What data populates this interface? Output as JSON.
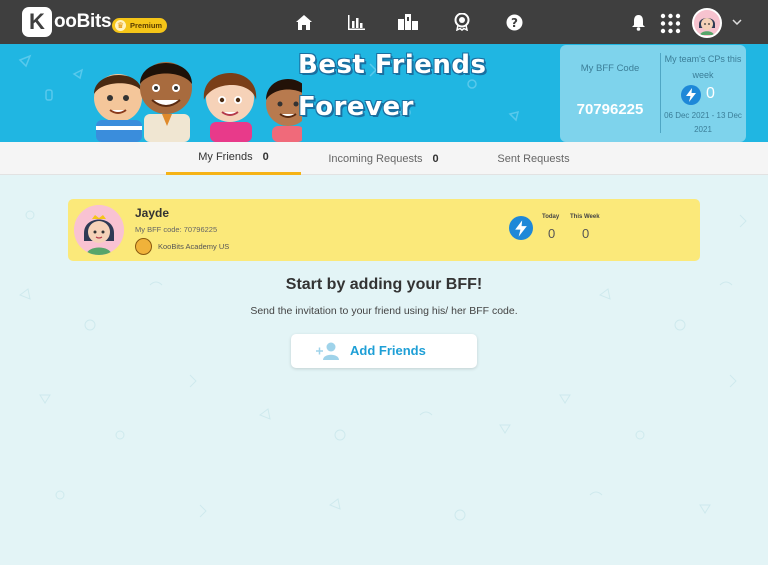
{
  "app": {
    "logo_text": "KooBits",
    "logo_letter": "K",
    "premium_label": "Premium"
  },
  "nav": [
    {
      "name": "home-icon"
    },
    {
      "name": "report-chart-icon"
    },
    {
      "name": "leaderboard-icon"
    },
    {
      "name": "achievements-medal-icon"
    },
    {
      "name": "help-icon"
    }
  ],
  "banner": {
    "title_line1": "Best Friends",
    "title_line2": "Forever",
    "bff_code_label": "My BFF Code",
    "bff_code": "70796225",
    "team_label": "My team's CPs this week",
    "team_cps": "0",
    "team_dates": "06 Dec 2021 - 13 Dec 2021"
  },
  "tabs": [
    {
      "label": "My Friends",
      "count": "0",
      "active": true
    },
    {
      "label": "Incoming Requests",
      "count": "0",
      "active": false
    },
    {
      "label": "Sent Requests",
      "count": "",
      "active": false
    }
  ],
  "friend": {
    "name": "Jayde",
    "code_text": "My BFF code: 70796225",
    "school": "KooBits Academy US",
    "today_label": "Today",
    "today_value": "0",
    "week_label": "This Week",
    "week_value": "0"
  },
  "empty_state": {
    "title": "Start by adding your BFF!",
    "subtitle": "Send the invitation to your friend using his/ her BFF code.",
    "button_label": "Add Friends"
  },
  "colors": {
    "topbar": "#3f3f3f",
    "banner": "#20b6e2",
    "friend_card": "#fbe97a",
    "tab_active": "#f5b316",
    "accent_blue": "#1e9fd6"
  }
}
